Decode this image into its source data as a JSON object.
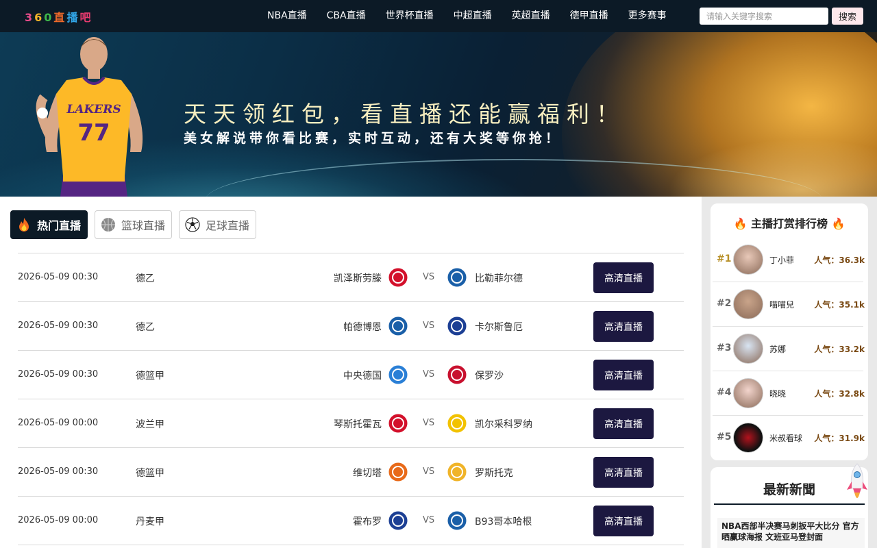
{
  "header": {
    "logo_chars": [
      {
        "text": "3",
        "color": "#e84c8a"
      },
      {
        "text": "6",
        "color": "#f0b429"
      },
      {
        "text": "0",
        "color": "#3fb94b"
      },
      {
        "text": "直",
        "color": "#f06a2a"
      },
      {
        "text": "播",
        "color": "#31a6e8"
      },
      {
        "text": "吧",
        "color": "#e83b6f"
      }
    ],
    "nav": [
      "NBA直播",
      "CBA直播",
      "世界杯直播",
      "中超直播",
      "英超直播",
      "德甲直播",
      "更多赛事"
    ],
    "search_placeholder": "请输入关键字搜索",
    "search_button": "搜索"
  },
  "banner": {
    "title": "天天领红包，看直播还能赢福利！",
    "subtitle": "美女解说带你看比赛，实时互动，还有大奖等你抢！",
    "player_jersey_text": "LAKERS",
    "player_number": "77"
  },
  "tabs": [
    {
      "label": "热门直播",
      "icon": "fire-icon",
      "active": true
    },
    {
      "label": "篮球直播",
      "icon": "basketball-icon",
      "active": false
    },
    {
      "label": "足球直播",
      "icon": "soccer-ball-icon",
      "active": false
    }
  ],
  "matches": [
    {
      "time": "2026-05-09 00:30",
      "league": "德乙",
      "home": "凯泽斯劳滕",
      "away": "比勒菲尔德",
      "vs": "VS",
      "button": "高清直播",
      "home_color": "#d3102b",
      "away_color": "#1a5fa8"
    },
    {
      "time": "2026-05-09 00:30",
      "league": "德乙",
      "home": "帕德博恩",
      "away": "卡尔斯鲁厄",
      "vs": "VS",
      "button": "高清直播",
      "home_color": "#1a5fa8",
      "away_color": "#1c3f94"
    },
    {
      "time": "2026-05-09 00:30",
      "league": "德篮甲",
      "home": "中央德国",
      "away": "保罗沙",
      "vs": "VS",
      "button": "高清直播",
      "home_color": "#2a7fd6",
      "away_color": "#c8102e"
    },
    {
      "time": "2026-05-09 00:00",
      "league": "波兰甲",
      "home": "琴斯托霍瓦",
      "away": "凯尔采科罗纳",
      "vs": "VS",
      "button": "高清直播",
      "home_color": "#d3102b",
      "away_color": "#f2c200"
    },
    {
      "time": "2026-05-09 00:30",
      "league": "德篮甲",
      "home": "维切塔",
      "away": "罗斯托克",
      "vs": "VS",
      "button": "高清直播",
      "home_color": "#e86a1a",
      "away_color": "#f0b429"
    },
    {
      "time": "2026-05-09 00:00",
      "league": "丹麦甲",
      "home": "霍布罗",
      "away": "B93哥本哈根",
      "vs": "VS",
      "button": "高清直播",
      "home_color": "#1c3f94",
      "away_color": "#1a5fa8"
    }
  ],
  "ranking": {
    "title": "主播打赏排行榜",
    "pop_label": "人气：",
    "items": [
      {
        "rank": "#1",
        "name": "丁小菲",
        "pop": "36.3k"
      },
      {
        "rank": "#2",
        "name": "喵喵兒",
        "pop": "35.1k"
      },
      {
        "rank": "#3",
        "name": "苏娜",
        "pop": "33.2k"
      },
      {
        "rank": "#4",
        "name": "晓晓",
        "pop": "32.8k"
      },
      {
        "rank": "#5",
        "name": "米叔看球",
        "pop": "31.9k"
      }
    ]
  },
  "news": {
    "title": "最新新聞",
    "items": [
      "NBA西部半决赛马刺扳平大比分 官方晒赢球海报 文班亚马登封面"
    ]
  },
  "colors": {
    "header_bg": "#0c1a26",
    "button_bg": "#1c1840",
    "rank_first": "#b8912a",
    "pop_text": "#7a4a14"
  }
}
